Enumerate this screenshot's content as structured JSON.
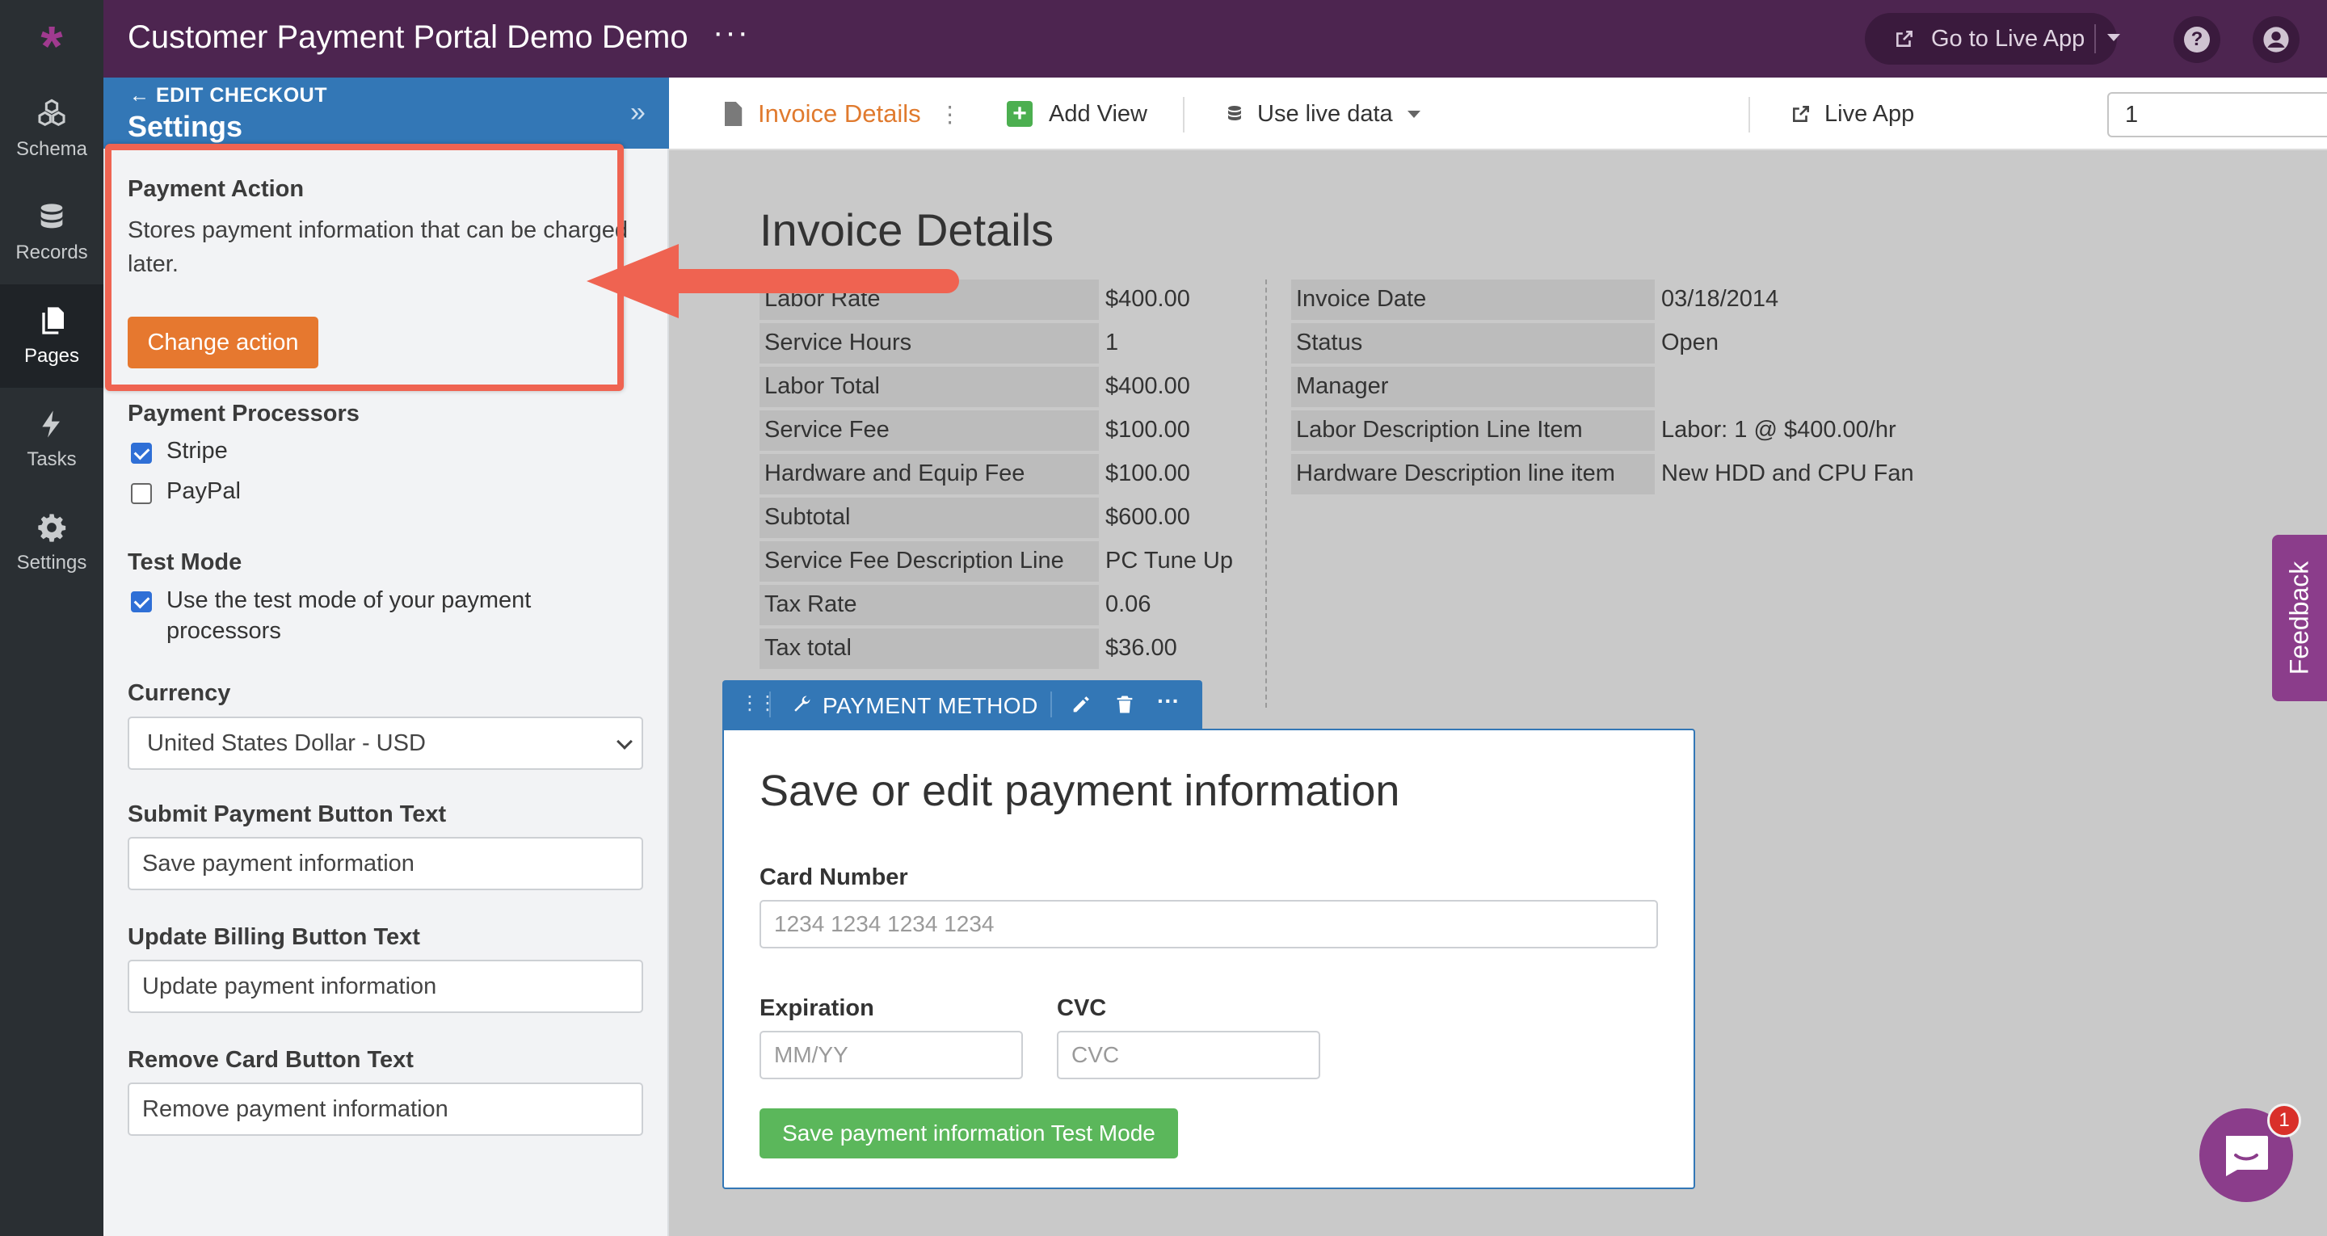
{
  "app": {
    "title": "Customer Payment Portal Demo Demo",
    "menu_glyph": "···",
    "logo": "*"
  },
  "topbar": {
    "live_app_label": "Go to Live App",
    "help_glyph": "?"
  },
  "rail": [
    {
      "label": "Schema",
      "icon": "schema-icon"
    },
    {
      "label": "Records",
      "icon": "database-icon"
    },
    {
      "label": "Pages",
      "icon": "pages-icon",
      "active": true
    },
    {
      "label": "Tasks",
      "icon": "lightning-icon"
    },
    {
      "label": "Settings",
      "icon": "gear-icon"
    }
  ],
  "panel": {
    "back_label": "EDIT CHECKOUT",
    "title": "Settings",
    "payment_action": {
      "label": "Payment Action",
      "description": "Stores payment information that can be charged later.",
      "button": "Change action"
    },
    "processors": {
      "label": "Payment Processors",
      "items": [
        {
          "label": "Stripe",
          "checked": true
        },
        {
          "label": "PayPal",
          "checked": false
        }
      ]
    },
    "test_mode": {
      "label": "Test Mode",
      "checkbox_label": "Use the test mode of your payment processors",
      "checked": true
    },
    "currency": {
      "label": "Currency",
      "value": "United States Dollar - USD"
    },
    "submit_text": {
      "label": "Submit Payment Button Text",
      "value": "Save payment information"
    },
    "update_text": {
      "label": "Update Billing Button Text",
      "value": "Update payment information"
    },
    "remove_text": {
      "label": "Remove Card Button Text",
      "value": "Remove payment information"
    }
  },
  "viewbar": {
    "page_name": "Invoice Details",
    "add_view": "Add View",
    "live_data": "Use live data",
    "record_value": "1",
    "live_app": "Live App"
  },
  "canvas": {
    "heading": "Invoice Details",
    "left_details": [
      {
        "label": "Labor Rate",
        "value": "$400.00"
      },
      {
        "label": "Service Hours",
        "value": "1"
      },
      {
        "label": "Labor Total",
        "value": "$400.00"
      },
      {
        "label": "Service Fee",
        "value": "$100.00"
      },
      {
        "label": "Hardware and Equip Fee",
        "value": "$100.00"
      },
      {
        "label": "Subtotal",
        "value": "$600.00"
      },
      {
        "label": "Service Fee Description Line",
        "value": "PC Tune Up"
      },
      {
        "label": "Tax Rate",
        "value": "0.06"
      },
      {
        "label": "Tax total",
        "value": "$36.00"
      }
    ],
    "right_details": [
      {
        "label": "Invoice Date",
        "value": "03/18/2014"
      },
      {
        "label": "Status",
        "value": "Open"
      },
      {
        "label": "Manager",
        "value": ""
      },
      {
        "label": "Labor Description Line Item",
        "value": "Labor: 1 @ $400.00/hr"
      },
      {
        "label": "Hardware Description line item",
        "value": "New HDD and CPU Fan"
      }
    ],
    "payment_view": {
      "toolbar_label": "PAYMENT METHOD",
      "title": "Save or edit payment information",
      "card_label": "Card Number",
      "card_placeholder": "1234 1234 1234 1234",
      "exp_label": "Expiration",
      "exp_placeholder": "MM/YY",
      "cvc_label": "CVC",
      "cvc_placeholder": "CVC",
      "save_button": "Save payment information Test Mode"
    }
  },
  "feedback": {
    "label": "Feedback"
  },
  "chat": {
    "badge": "1"
  },
  "colors": {
    "topbar": "#4d2550",
    "rail": "#2a2f33",
    "panel_header": "#3377b6",
    "accent_orange": "#e6782f",
    "save_green": "#5bb75b",
    "highlight_red": "#ef6351",
    "feedback_purple": "#8b3d8b"
  }
}
